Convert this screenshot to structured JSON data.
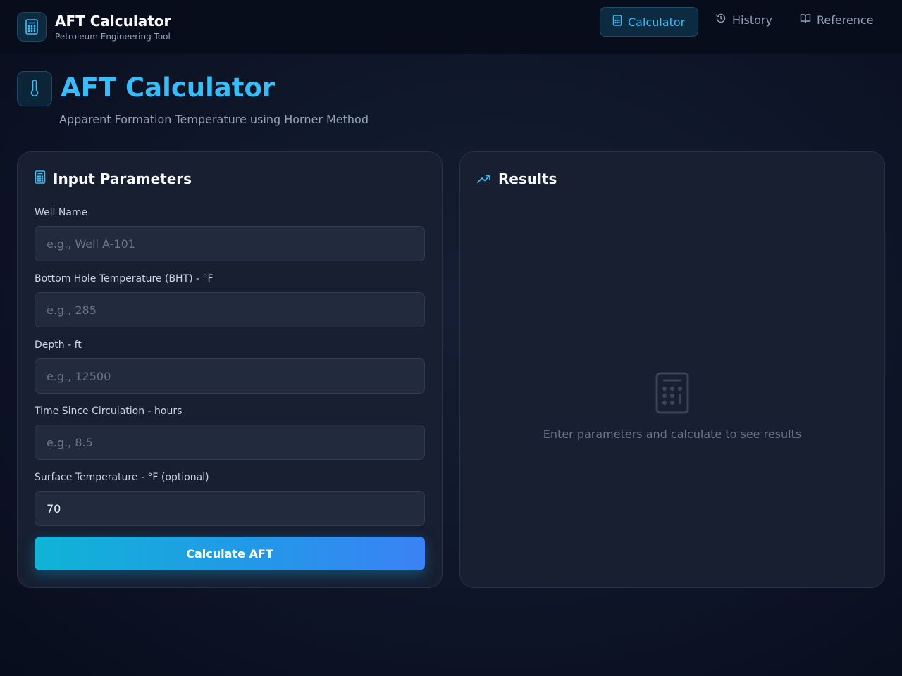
{
  "header": {
    "brand_title": "AFT Calculator",
    "brand_subtitle": "Petroleum Engineering Tool",
    "nav": [
      {
        "label": "Calculator",
        "icon": "calculator-icon",
        "active": true
      },
      {
        "label": "History",
        "icon": "history-icon",
        "active": false
      },
      {
        "label": "Reference",
        "icon": "book-icon",
        "active": false
      }
    ]
  },
  "page": {
    "title": "AFT Calculator",
    "subtitle": "Apparent Formation Temperature using Horner Method",
    "title_icon": "thermometer-icon"
  },
  "inputs": {
    "heading": "Input Parameters",
    "fields": [
      {
        "label": "Well Name",
        "placeholder": "e.g., Well A-101",
        "value": ""
      },
      {
        "label": "Bottom Hole Temperature (BHT) - °F",
        "placeholder": "e.g., 285",
        "value": ""
      },
      {
        "label": "Depth - ft",
        "placeholder": "e.g., 12500",
        "value": ""
      },
      {
        "label": "Time Since Circulation - hours",
        "placeholder": "e.g., 8.5",
        "value": ""
      },
      {
        "label": "Surface Temperature - °F (optional)",
        "placeholder": "",
        "value": "70"
      }
    ],
    "button_label": "Calculate AFT"
  },
  "results": {
    "heading": "Results",
    "empty_message": "Enter parameters and calculate to see results"
  },
  "colors": {
    "accent": "#38bdf8",
    "background": "#0f172a",
    "card": "#171f31",
    "button_start": "#0fb4d6",
    "button_end": "#3b82f6"
  }
}
